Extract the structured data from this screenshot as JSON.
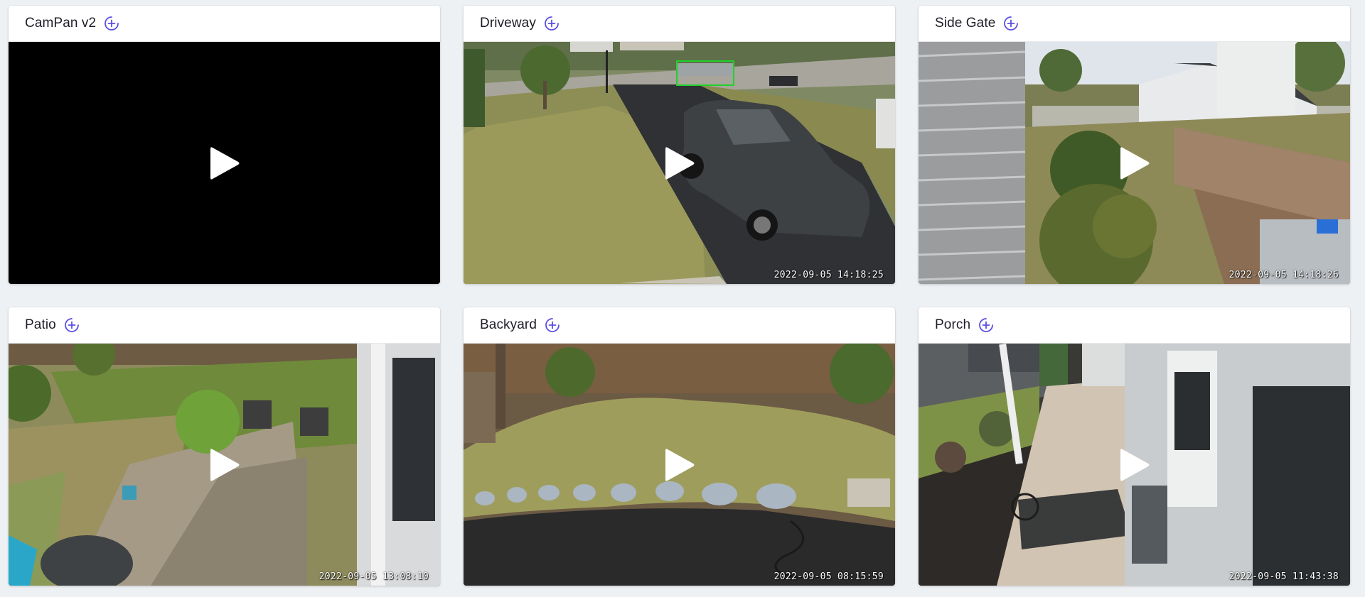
{
  "colors": {
    "page_bg": "#eef1f4",
    "accent": "#5b4fe0",
    "title_text": "#1e1e28"
  },
  "cameras": [
    {
      "name": "CamPan v2",
      "timestamp": "",
      "feed": "black",
      "icon": "add-circle-icon"
    },
    {
      "name": "Driveway",
      "timestamp": "2022-09-05 14:18:25",
      "feed": "driveway",
      "icon": "add-circle-icon"
    },
    {
      "name": "Side Gate",
      "timestamp": "2022-09-05 14:18:26",
      "feed": "side-gate",
      "icon": "add-circle-icon"
    },
    {
      "name": "Patio",
      "timestamp": "2022-09-05 13:08:10",
      "feed": "patio",
      "icon": "add-circle-icon"
    },
    {
      "name": "Backyard",
      "timestamp": "2022-09-05 08:15:59",
      "feed": "backyard",
      "icon": "add-circle-icon"
    },
    {
      "name": "Porch",
      "timestamp": "2022-09-05 11:43:38",
      "feed": "porch",
      "icon": "add-circle-icon"
    }
  ]
}
